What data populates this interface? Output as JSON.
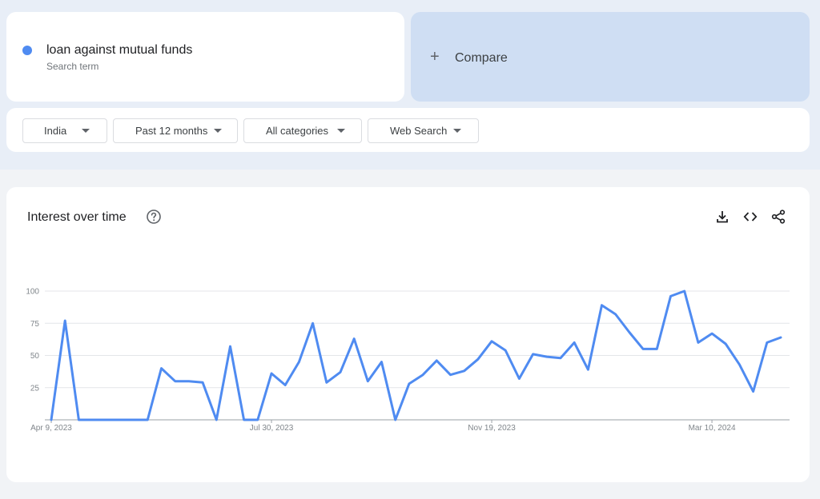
{
  "search_term": {
    "label": "loan against mutual funds",
    "sublabel": "Search term",
    "color": "#4f8bf1"
  },
  "compare": {
    "label": "Compare",
    "icon": "plus-icon"
  },
  "filters": [
    {
      "label": "India"
    },
    {
      "label": "Past 12 months"
    },
    {
      "label": "All categories"
    },
    {
      "label": "Web Search"
    }
  ],
  "chart_section": {
    "title": "Interest over time",
    "help_icon": "question-circle-icon",
    "tools": [
      "download-icon",
      "embed-code-icon",
      "share-icon"
    ]
  },
  "chart_data": {
    "type": "line",
    "ylim": [
      0,
      100
    ],
    "y_ticks": [
      "100",
      "75",
      "50",
      "25"
    ],
    "x_tick_labels": [
      "Apr 9, 2023",
      "Jul 30, 2023",
      "Nov 19, 2023",
      "Mar 10, 2024"
    ],
    "series": [
      {
        "color": "#4f8bf1",
        "values": [
          0,
          77,
          0,
          0,
          0,
          0,
          0,
          0,
          40,
          30,
          30,
          29,
          0,
          57,
          0,
          0,
          36,
          27,
          45,
          75,
          29,
          37,
          63,
          30,
          45,
          0,
          28,
          35,
          46,
          35,
          38,
          47,
          61,
          54,
          32,
          51,
          49,
          48,
          60,
          39,
          89,
          82,
          68,
          55,
          55,
          96,
          100,
          60,
          67,
          59,
          43,
          22,
          60,
          64
        ]
      }
    ]
  }
}
